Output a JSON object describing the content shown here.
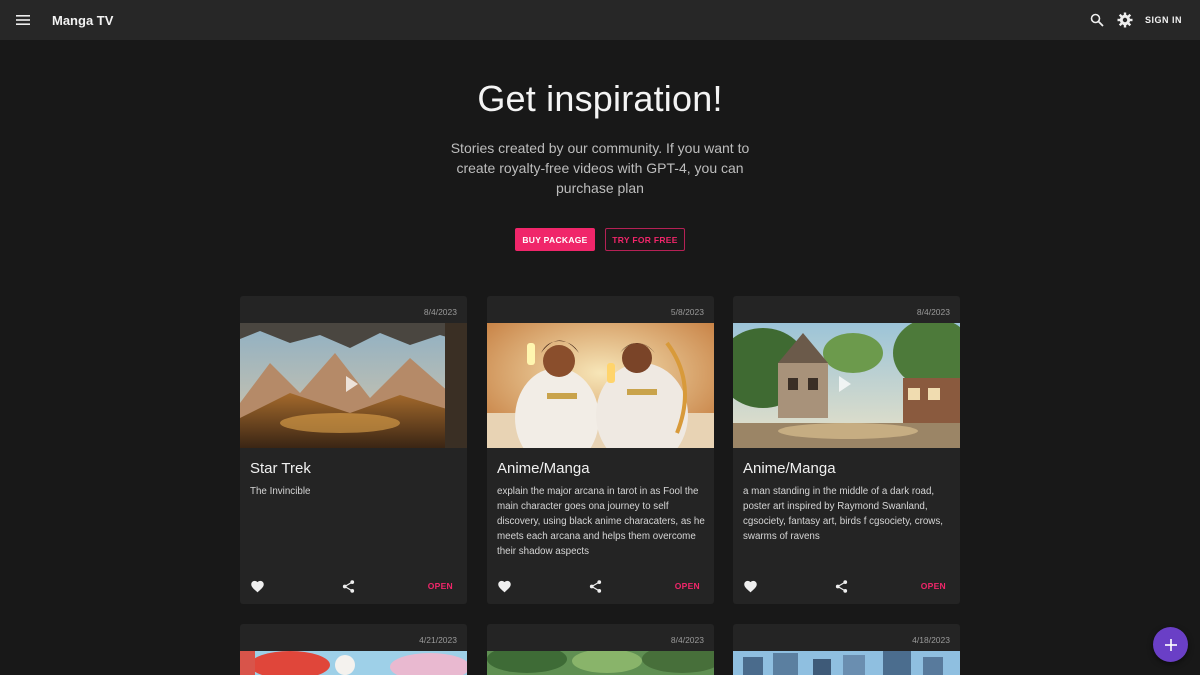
{
  "appbar": {
    "title": "Manga TV",
    "signin_label": "SIGN IN",
    "icons": [
      "menu-icon",
      "search-icon",
      "gear-icon"
    ]
  },
  "hero": {
    "title": "Get inspiration!",
    "subtitle": "Stories created by our community. If you want to create royalty-free videos with GPT-4, you can purchase plan",
    "buy_label": "BUY PACKAGE",
    "try_label": "TRY FOR FREE"
  },
  "cards": [
    {
      "date": "8/4/2023",
      "title": "Star Trek",
      "description": "The Invincible",
      "open_label": "OPEN"
    },
    {
      "date": "5/8/2023",
      "title": "Anime/Manga",
      "description": "explain the major arcana in tarot in as Fool the main character goes ona journey to self discovery, using black anime characaters, as he meets each arcana and helps them overcome their shadow aspects",
      "open_label": "OPEN"
    },
    {
      "date": "8/4/2023",
      "title": "Anime/Manga",
      "description": "a man standing in the middle of a dark road, poster art inspired by Raymond Swanland, cgsociety, fantasy art, birds f cgsociety, crows, swarms of ravens",
      "open_label": "OPEN"
    },
    {
      "date": "4/21/2023"
    },
    {
      "date": "8/4/2023"
    },
    {
      "date": "4/18/2023"
    }
  ],
  "colors": {
    "accent": "#f0266a",
    "fab": "#6a3fc6",
    "appbar": "#272727",
    "background": "#181818",
    "card": "#242424"
  }
}
